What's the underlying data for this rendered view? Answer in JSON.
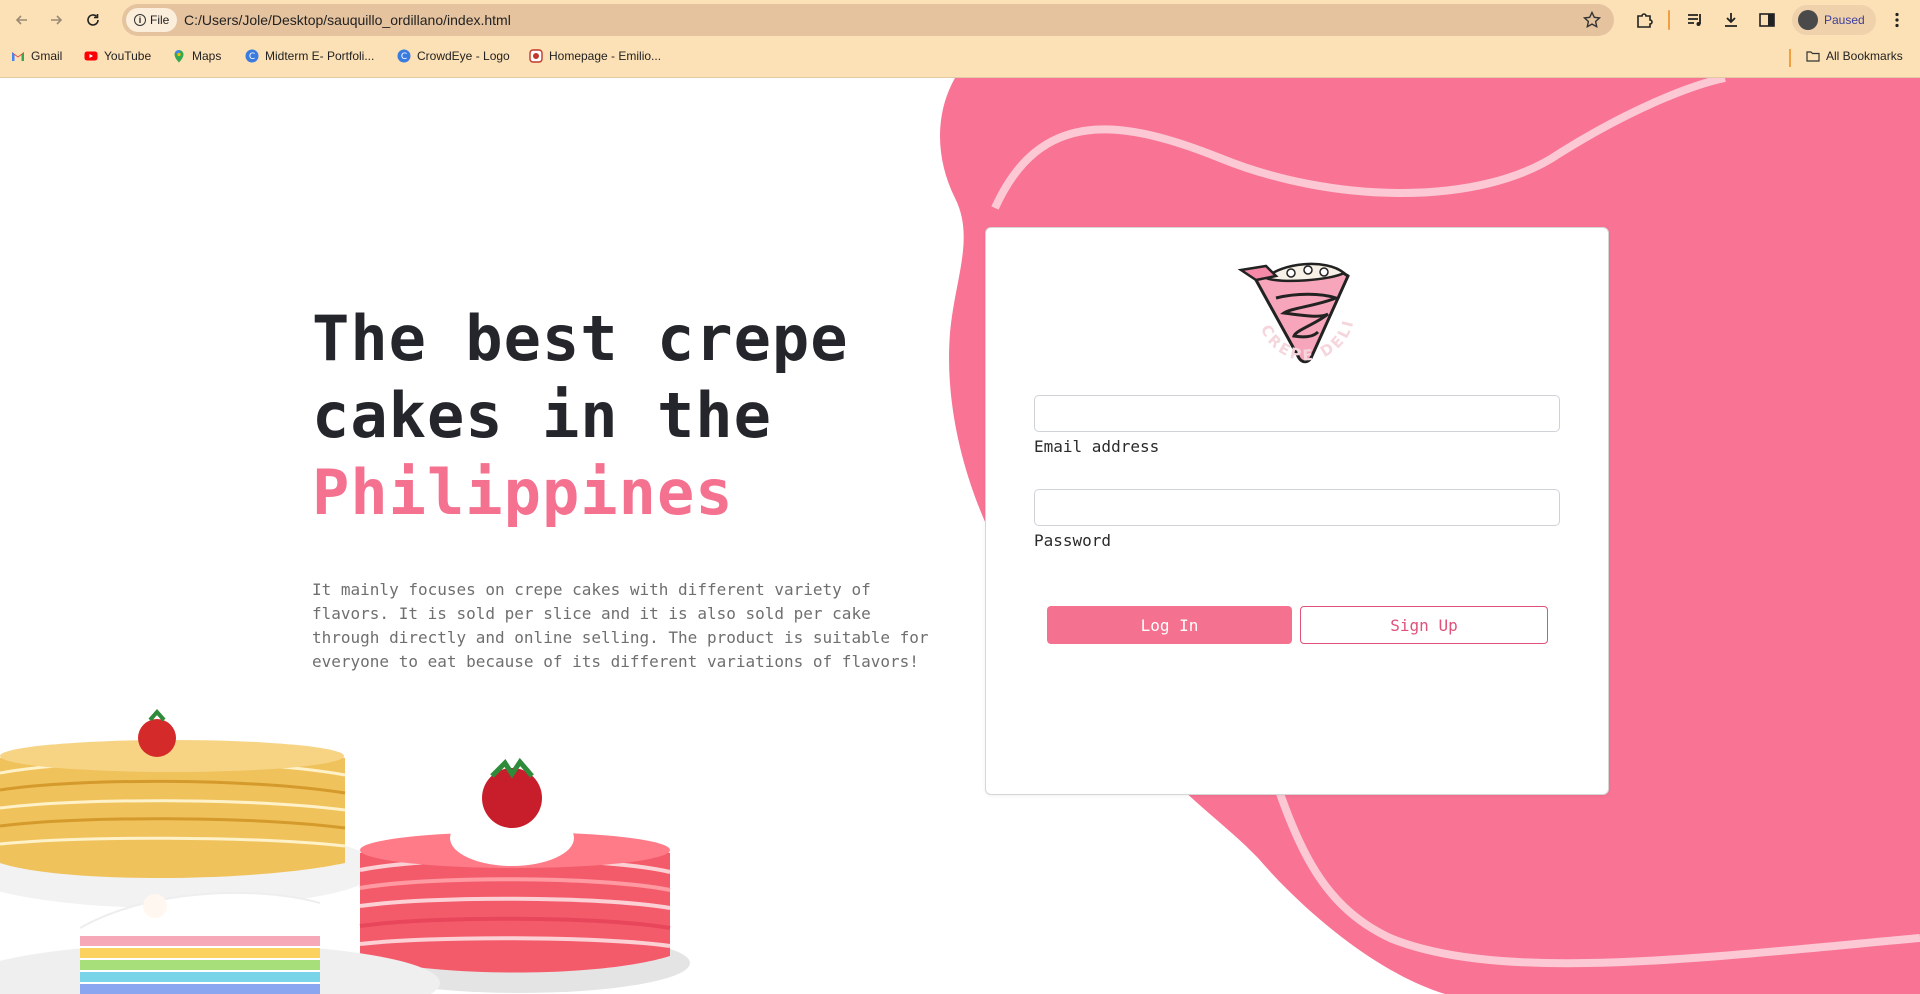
{
  "browser": {
    "chip_label": "File",
    "url": "C:/Users/Jole/Desktop/sauquillo_ordillano/index.html",
    "profile_status": "Paused",
    "bookmarks": [
      {
        "label": "Gmail",
        "icon": "gmail-icon"
      },
      {
        "label": "YouTube",
        "icon": "youtube-icon"
      },
      {
        "label": "Maps",
        "icon": "maps-icon"
      },
      {
        "label": "Midterm E- Portfoli...",
        "icon": "canva-icon"
      },
      {
        "label": "CrowdEye - Logo",
        "icon": "canva-icon"
      },
      {
        "label": "Homepage - Emilio...",
        "icon": "site-icon"
      }
    ],
    "all_bookmarks_label": "All Bookmarks"
  },
  "hero": {
    "title_line1": "The best crepe",
    "title_line2": "cakes in the",
    "title_accent": "Philippines",
    "description": "It mainly focuses on crepe cakes with different variety of flavors. It is sold per slice and it is also sold per cake through directly and online selling. The product is suitable for everyone to eat because of its different variations of flavors!"
  },
  "login": {
    "logo_text": "CREPE DELIGHT",
    "email_label": "Email address",
    "email_value": "",
    "password_label": "Password",
    "password_value": "",
    "login_button": "Log In",
    "signup_button": "Sign Up"
  },
  "colors": {
    "accent": "#f4718f",
    "blob": "#f87394",
    "chrome": "#fce0b6",
    "title": "#24262b"
  }
}
